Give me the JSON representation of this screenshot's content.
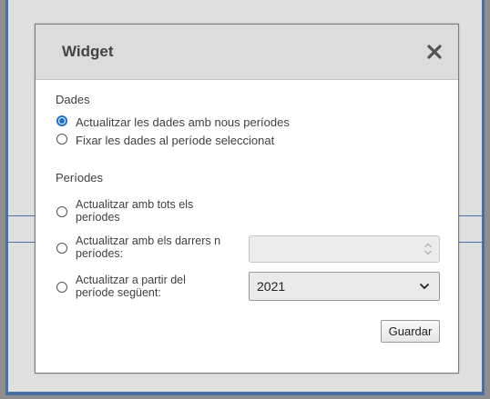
{
  "dialog": {
    "title": "Widget",
    "close_icon": "close-x-icon"
  },
  "dades": {
    "label": "Dades",
    "options": [
      {
        "label": "Actualitzar les dades amb nous períodes",
        "checked": true
      },
      {
        "label": "Fixar les dades al període seleccionat",
        "checked": false
      }
    ]
  },
  "periodes": {
    "label": "Períodes",
    "options": [
      {
        "label": "Actualitzar amb tots els\nperíodes",
        "checked": false
      },
      {
        "label": "Actualitzar amb els darrers n\nperíodes:",
        "checked": false
      },
      {
        "label": "Actualitzar a partir del\nperíode següent:",
        "checked": false
      }
    ],
    "last_n_input": {
      "value": "",
      "disabled": true
    },
    "start_period_select": {
      "value": "2021"
    }
  },
  "actions": {
    "save_label": "Guardar"
  },
  "colors": {
    "accent": "#1a6fd6",
    "frame": "#4a6fa5"
  }
}
